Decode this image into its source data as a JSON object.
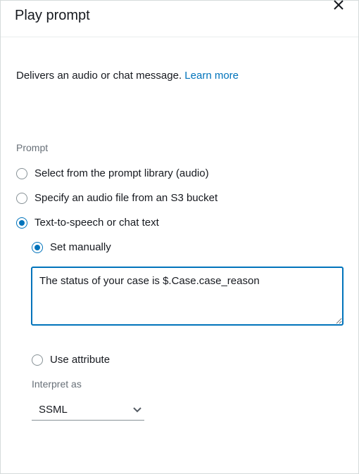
{
  "header": {
    "title": "Play prompt"
  },
  "description": {
    "text": "Delivers an audio or chat message. ",
    "link_text": "Learn more"
  },
  "prompt_section": {
    "label": "Prompt",
    "options": {
      "library": "Select from the prompt library (audio)",
      "s3": "Specify an audio file from an S3 bucket",
      "tts": "Text-to-speech or chat text"
    },
    "tts_sub": {
      "set_manually": "Set manually",
      "use_attribute": "Use attribute",
      "textarea_value": "The status of your case is $.Case.case_reason"
    },
    "interpret": {
      "label": "Interpret as",
      "value": "SSML"
    }
  }
}
